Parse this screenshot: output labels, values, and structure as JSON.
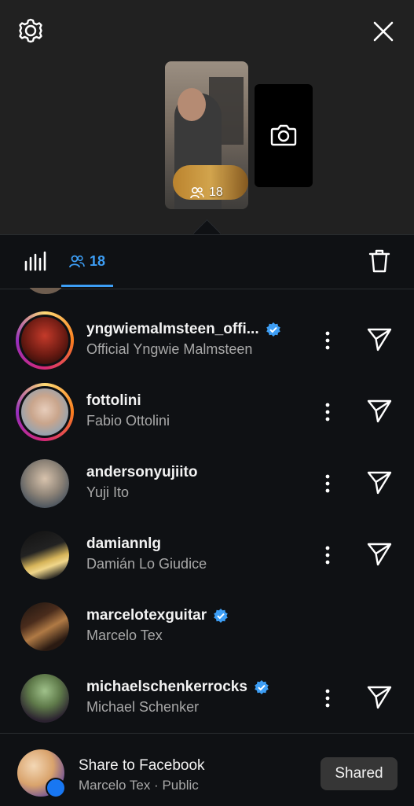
{
  "header": {
    "settings_icon": "gear-icon",
    "close_icon": "close-icon",
    "story_viewer_count": "18",
    "camera_icon": "camera-icon"
  },
  "tabs": {
    "stats_icon": "bar-chart-icon",
    "viewers_icon": "people-icon",
    "viewers_count": "18",
    "delete_icon": "trash-icon"
  },
  "viewers": [
    {
      "username": "yngwiemalmsteen_offi...",
      "name": "Official Yngwie Malmsteen",
      "verified": true,
      "story_ring": true,
      "send": true
    },
    {
      "username": "fottolini",
      "name": "Fabio Ottolini",
      "verified": false,
      "story_ring": true,
      "send": true
    },
    {
      "username": "andersonyujiito",
      "name": "Yuji Ito",
      "verified": false,
      "story_ring": false,
      "send": true
    },
    {
      "username": "damiannlg",
      "name": "Damián Lo Giudice",
      "verified": false,
      "story_ring": false,
      "send": true
    },
    {
      "username": "marcelotexguitar",
      "name": "Marcelo Tex",
      "verified": true,
      "story_ring": false,
      "send": false
    },
    {
      "username": "michaelschenkerrocks",
      "name": "Michael Schenker",
      "verified": true,
      "story_ring": false,
      "send": true
    }
  ],
  "share_facebook": {
    "title": "Share to Facebook",
    "subtitle": "Marcelo Tex · Public",
    "button_label": "Shared"
  },
  "colors": {
    "accent": "#3d9ef5",
    "verified": "#3d9ef5",
    "background": "#0f1114",
    "header_background": "#212121"
  }
}
